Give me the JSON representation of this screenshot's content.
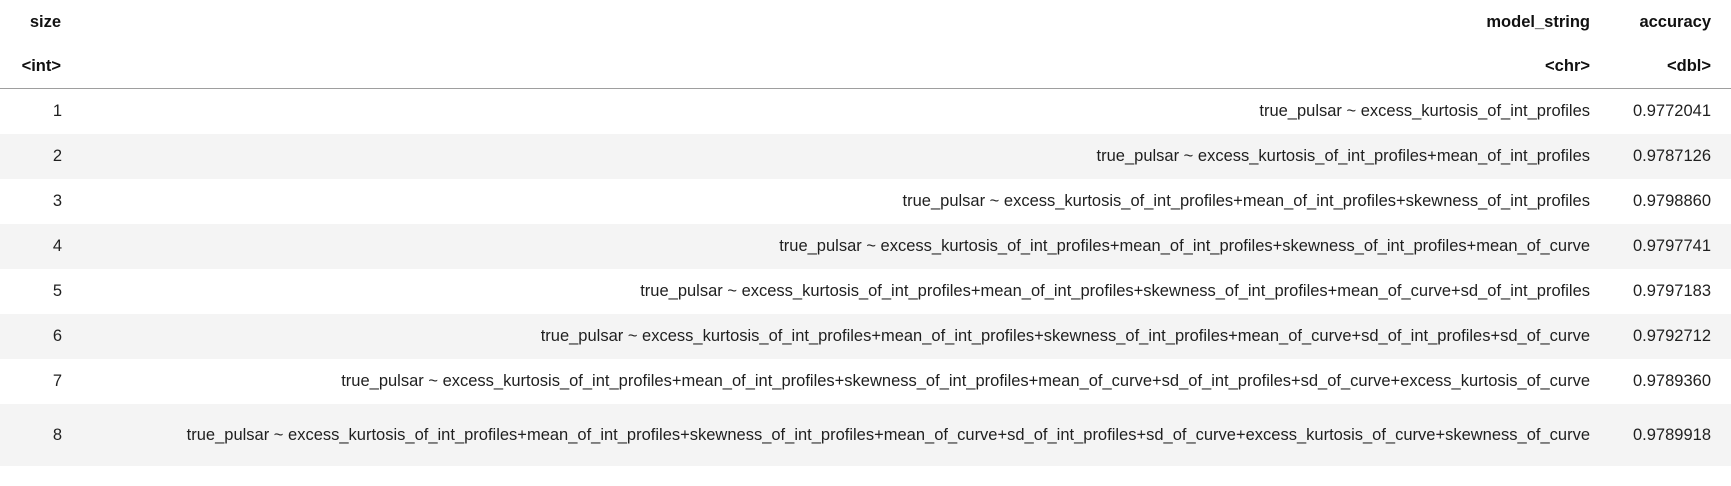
{
  "table": {
    "headers": {
      "size": "size",
      "model_string": "model_string",
      "accuracy": "accuracy"
    },
    "types": {
      "size": "<int>",
      "model_string": "<chr>",
      "accuracy": "<dbl>"
    },
    "rows": [
      {
        "size": "1",
        "model_string": "true_pulsar ~ excess_kurtosis_of_int_profiles",
        "accuracy": "0.9772041"
      },
      {
        "size": "2",
        "model_string": "true_pulsar ~ excess_kurtosis_of_int_profiles+mean_of_int_profiles",
        "accuracy": "0.9787126"
      },
      {
        "size": "3",
        "model_string": "true_pulsar ~ excess_kurtosis_of_int_profiles+mean_of_int_profiles+skewness_of_int_profiles",
        "accuracy": "0.9798860"
      },
      {
        "size": "4",
        "model_string": "true_pulsar ~ excess_kurtosis_of_int_profiles+mean_of_int_profiles+skewness_of_int_profiles+mean_of_curve",
        "accuracy": "0.9797741"
      },
      {
        "size": "5",
        "model_string": "true_pulsar ~ excess_kurtosis_of_int_profiles+mean_of_int_profiles+skewness_of_int_profiles+mean_of_curve+sd_of_int_profiles",
        "accuracy": "0.9797183"
      },
      {
        "size": "6",
        "model_string": "true_pulsar ~ excess_kurtosis_of_int_profiles+mean_of_int_profiles+skewness_of_int_profiles+mean_of_curve+sd_of_int_profiles+sd_of_curve",
        "accuracy": "0.9792712"
      },
      {
        "size": "7",
        "model_string": "true_pulsar ~ excess_kurtosis_of_int_profiles+mean_of_int_profiles+skewness_of_int_profiles+mean_of_curve+sd_of_int_profiles+sd_of_curve+excess_kurtosis_of_curve",
        "accuracy": "0.9789360"
      },
      {
        "size": "8",
        "model_string": "true_pulsar ~ excess_kurtosis_of_int_profiles+mean_of_int_profiles+skewness_of_int_profiles+mean_of_curve+sd_of_int_profiles+sd_of_curve+excess_kurtosis_of_curve+skewness_of_curve",
        "accuracy": "0.9789918"
      }
    ]
  }
}
